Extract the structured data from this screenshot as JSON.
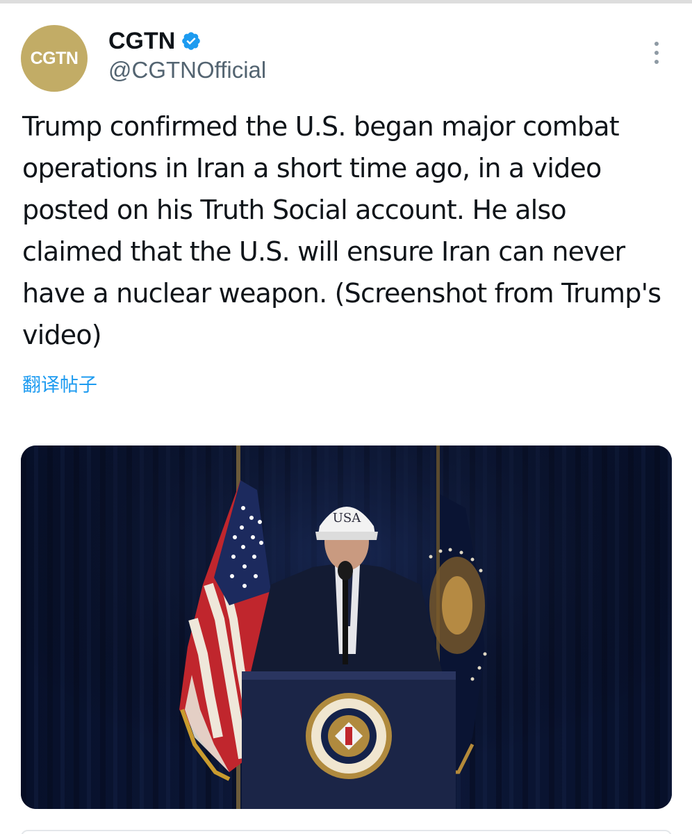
{
  "post": {
    "avatar_text": "CGTN",
    "display_name": "CGTN",
    "handle": "@CGTNOfficial",
    "verified": true,
    "text": "Trump confirmed the U.S. began major combat operations in Iran a short time ago, in a video posted on his Truth Social account. He also claimed that the U.S. will ensure Iran can never have a nuclear weapon. (Screenshot from Trump's video)",
    "translate_label": "翻译帖子",
    "media": {
      "cap_text": "USA"
    }
  },
  "icons": {
    "verified": "verified-badge-icon",
    "more": "more-options-icon"
  },
  "colors": {
    "accent": "#1d9bf0",
    "avatar_bg": "#c2ac66",
    "text_primary": "#0f1419",
    "text_secondary": "#536471"
  }
}
